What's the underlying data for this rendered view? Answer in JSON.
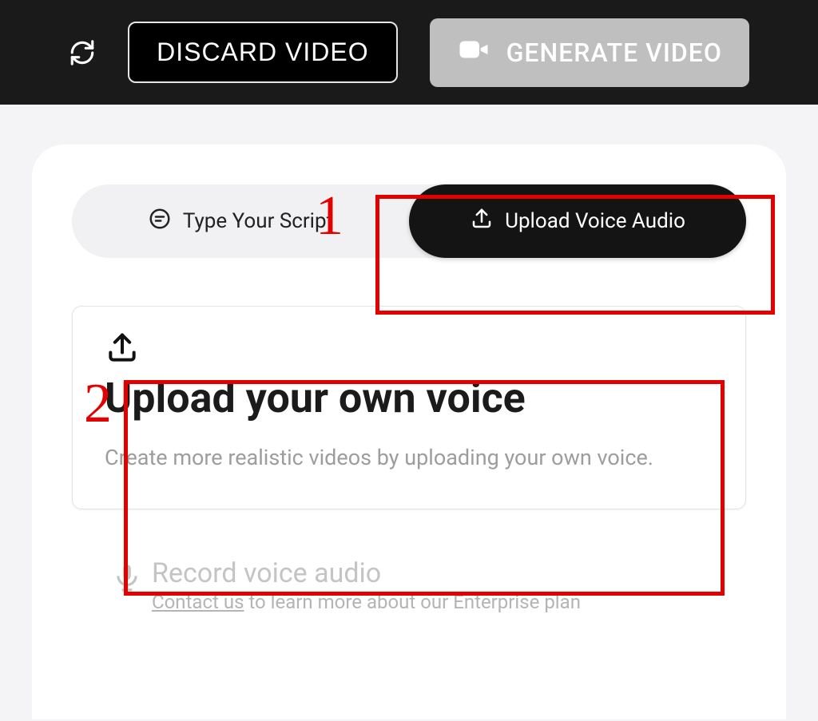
{
  "topbar": {
    "discard_label": "DISCARD VIDEO",
    "generate_label": "GENERATE VIDEO"
  },
  "toggle": {
    "type_script_label": "Type Your Script",
    "upload_audio_label": "Upload Voice Audio"
  },
  "upload_card": {
    "heading": "Upload your own voice",
    "description": "Create more realistic videos by uploading your own voice."
  },
  "record": {
    "title": "Record voice audio",
    "contact_label": "Contact us",
    "rest": " to learn more about our Enterprise plan"
  },
  "annotations": {
    "label1": "1",
    "label2": "2"
  }
}
